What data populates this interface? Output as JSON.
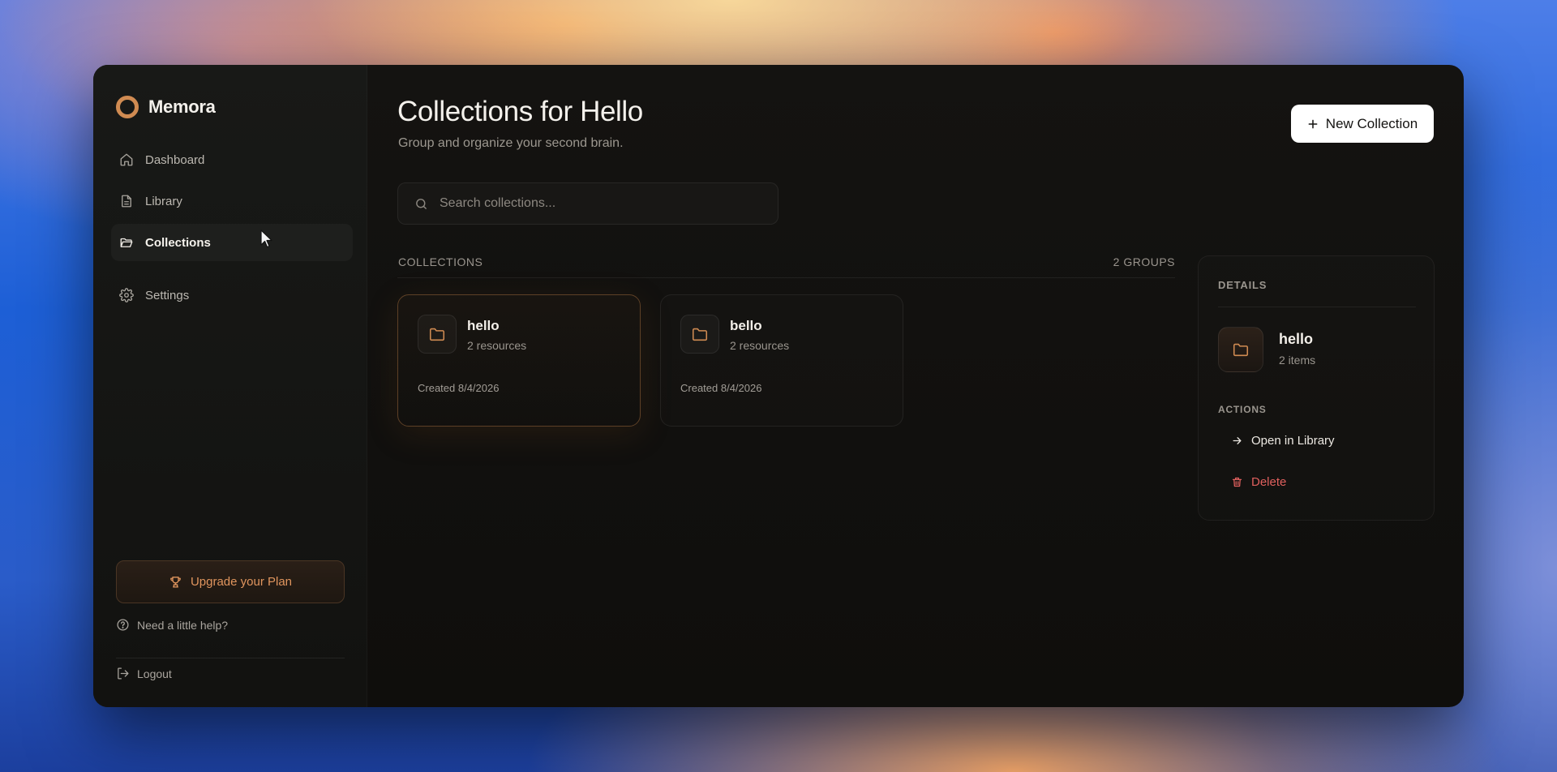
{
  "app": {
    "brand": "Memora"
  },
  "sidebar": {
    "items": [
      {
        "label": "Dashboard",
        "icon": "home-icon"
      },
      {
        "label": "Library",
        "icon": "document-icon"
      },
      {
        "label": "Collections",
        "icon": "folder-open-icon",
        "active": true
      },
      {
        "label": "Settings",
        "icon": "gear-icon"
      }
    ],
    "upgrade_label": "Upgrade your Plan",
    "help_label": "Need a little help?",
    "logout_label": "Logout"
  },
  "header": {
    "title": "Collections for Hello",
    "subtitle": "Group and organize your second brain.",
    "new_button_label": "New Collection"
  },
  "search": {
    "placeholder": "Search collections..."
  },
  "collections": {
    "section_label": "COLLECTIONS",
    "count_label": "2 GROUPS",
    "items": [
      {
        "name": "hello",
        "count": "2 resources",
        "created": "Created 8/4/2026",
        "selected": true
      },
      {
        "name": "bello",
        "count": "2 resources",
        "created": "Created 8/4/2026",
        "selected": false
      }
    ]
  },
  "details": {
    "label": "DETAILS",
    "name": "hello",
    "count": "2 items",
    "actions_label": "ACTIONS",
    "open_label": "Open in Library",
    "delete_label": "Delete"
  },
  "colors": {
    "accent": "#d08b52",
    "danger": "#e0605e",
    "primary_button": "#ffffff"
  }
}
